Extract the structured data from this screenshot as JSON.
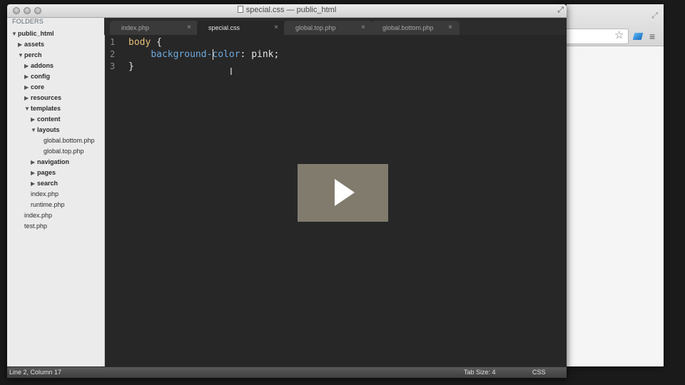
{
  "window": {
    "title": "special.css — public_html"
  },
  "sidebar": {
    "heading": "FOLDERS",
    "tree": [
      {
        "label": "public_html",
        "type": "folder",
        "state": "open",
        "depth": 0
      },
      {
        "label": "assets",
        "type": "folder",
        "state": "closed",
        "depth": 1
      },
      {
        "label": "perch",
        "type": "folder",
        "state": "open",
        "depth": 1
      },
      {
        "label": "addons",
        "type": "folder",
        "state": "closed",
        "depth": 2
      },
      {
        "label": "config",
        "type": "folder",
        "state": "closed",
        "depth": 2
      },
      {
        "label": "core",
        "type": "folder",
        "state": "closed",
        "depth": 2
      },
      {
        "label": "resources",
        "type": "folder",
        "state": "closed",
        "depth": 2
      },
      {
        "label": "templates",
        "type": "folder",
        "state": "open",
        "depth": 2
      },
      {
        "label": "content",
        "type": "folder",
        "state": "closed",
        "depth": 3
      },
      {
        "label": "layouts",
        "type": "folder",
        "state": "open",
        "depth": 3
      },
      {
        "label": "global.bottom.php",
        "type": "file",
        "depth": 4
      },
      {
        "label": "global.top.php",
        "type": "file",
        "depth": 4
      },
      {
        "label": "navigation",
        "type": "folder",
        "state": "closed",
        "depth": 3
      },
      {
        "label": "pages",
        "type": "folder",
        "state": "closed",
        "depth": 3
      },
      {
        "label": "search",
        "type": "folder",
        "state": "closed",
        "depth": 3
      },
      {
        "label": "index.php",
        "type": "file",
        "depth": 2
      },
      {
        "label": "runtime.php",
        "type": "file",
        "depth": 2
      },
      {
        "label": "index.php",
        "type": "file",
        "depth": 1
      },
      {
        "label": "test.php",
        "type": "file",
        "depth": 1
      }
    ]
  },
  "tabs": [
    {
      "label": "index.php",
      "active": false,
      "close": "×"
    },
    {
      "label": "special.css",
      "active": true,
      "close": "×"
    },
    {
      "label": "global.top.php",
      "active": false,
      "close": "×"
    },
    {
      "label": "global.bottom.php",
      "active": false,
      "close": "×"
    }
  ],
  "editor": {
    "line_numbers": [
      "1",
      "2",
      "3"
    ],
    "lines": [
      {
        "selector": "body",
        "brace": " {"
      },
      {
        "indent": "    ",
        "property": "background-color",
        "colon": ": ",
        "value": "pink",
        "semi": ";"
      },
      {
        "brace": "}"
      }
    ]
  },
  "statusbar": {
    "position": "Line 2, Column 17",
    "tab_size": "Tab Size: 4",
    "syntax": "CSS"
  },
  "icons": {
    "traffic_lights": "window-control-icon",
    "play": "play-icon",
    "cursor": "text-cursor-icon",
    "star": "bookmark-star-icon",
    "menu": "menu-icon"
  },
  "colors": {
    "editor_bg": "#272727",
    "selector": "#e6c07b",
    "property": "#6fa8dc",
    "sidebar_bg": "#ebebeb"
  }
}
